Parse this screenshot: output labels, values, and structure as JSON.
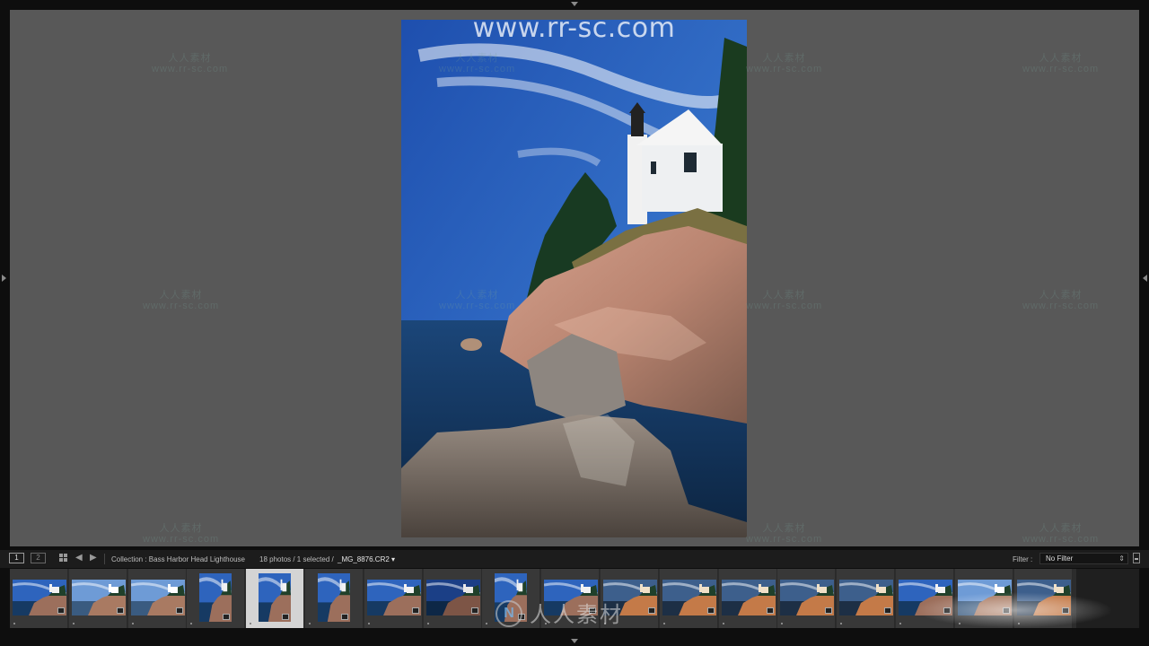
{
  "watermark": {
    "site": "www.rr-sc.com",
    "brand_cn": "人人素材",
    "brand_url": "www.rr-sc.com",
    "bottom_logo_letter": "N"
  },
  "toolbar": {
    "monitor_1": "1",
    "monitor_2": "2",
    "grid_icon": "grid-icon",
    "back_icon": "arrow-left-icon",
    "forward_icon": "arrow-right-icon",
    "collection": "Collection : Bass Harbor Head Lighthouse",
    "photo_count": "18 photos / 1 selected /",
    "selected_file": "_MG_8876.CR2",
    "filter_label": "Filter :",
    "filter_value": "No Filter"
  },
  "main_photo": {
    "subject": "lighthouse-on-rocks",
    "colors": {
      "sky": "#2a5db5",
      "sea": "#123a66",
      "rock": "#b98470"
    }
  },
  "filmstrip": {
    "selected_index": 4,
    "thumbnails": [
      {
        "orientation": "landscape",
        "style": "lighthouse-blue"
      },
      {
        "orientation": "landscape",
        "style": "lighthouse-bright"
      },
      {
        "orientation": "landscape",
        "style": "lighthouse-bright"
      },
      {
        "orientation": "portrait",
        "style": "lighthouse-blue"
      },
      {
        "orientation": "portrait",
        "style": "lighthouse-blue"
      },
      {
        "orientation": "portrait",
        "style": "lighthouse-blue"
      },
      {
        "orientation": "landscape",
        "style": "lighthouse-blue"
      },
      {
        "orientation": "landscape",
        "style": "lighthouse-deep"
      },
      {
        "orientation": "portrait",
        "style": "lighthouse-blue"
      },
      {
        "orientation": "landscape",
        "style": "lighthouse-blue"
      },
      {
        "orientation": "landscape",
        "style": "sunset"
      },
      {
        "orientation": "landscape",
        "style": "sunset"
      },
      {
        "orientation": "landscape",
        "style": "sunset"
      },
      {
        "orientation": "landscape",
        "style": "sunset"
      },
      {
        "orientation": "landscape",
        "style": "sunset"
      },
      {
        "orientation": "landscape",
        "style": "lighthouse-blue"
      },
      {
        "orientation": "landscape",
        "style": "lighthouse-bright"
      },
      {
        "orientation": "landscape",
        "style": "sunset"
      }
    ]
  }
}
